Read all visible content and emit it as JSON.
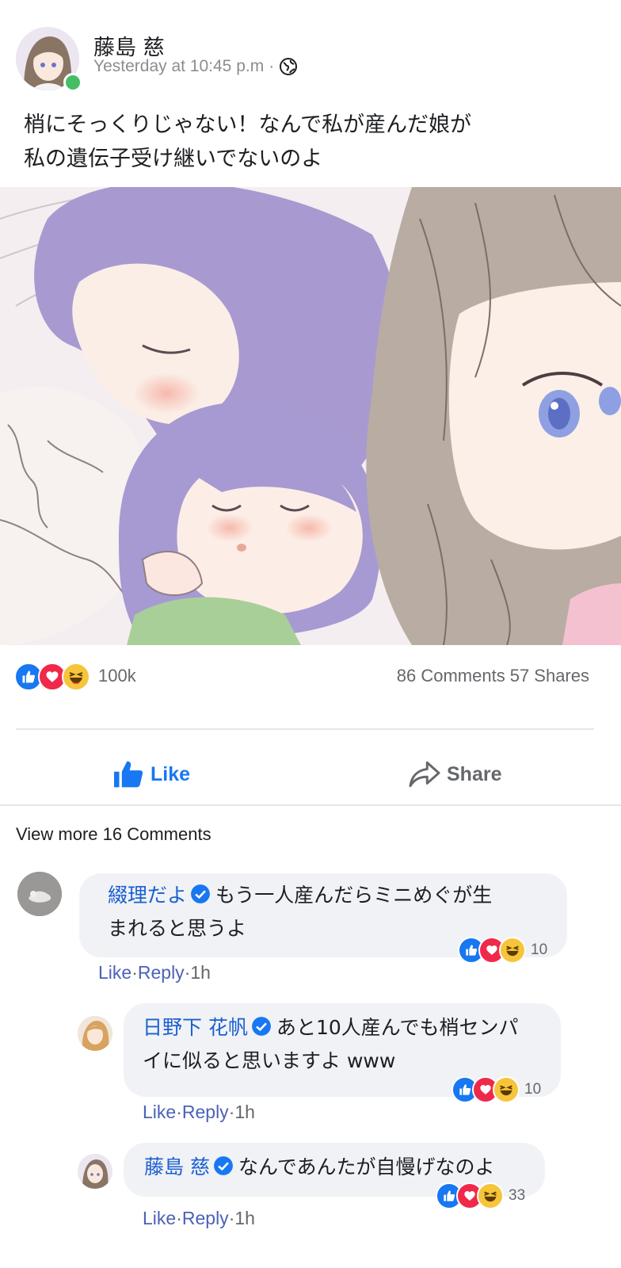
{
  "post": {
    "author": "藤島 慈",
    "timestamp": "Yesterday at 10:45 p.m",
    "separator": "·",
    "privacy_icon": "globe-icon",
    "online": true,
    "text_lines": [
      "梢にそっくりじゃない！なんで私が産んだ娘が",
      "私の遺伝子受け継いでないのよ"
    ],
    "image_icon": "illustration"
  },
  "stats": {
    "reactions": [
      "like",
      "love",
      "haha"
    ],
    "reaction_count": "100k",
    "comments": "86 Comments",
    "shares": "57 Shares"
  },
  "actions": {
    "like_label": "Like",
    "share_label": "Share"
  },
  "view_more": "View more 16 Comments",
  "comments": [
    {
      "name": "綴理だよ",
      "verified": true,
      "text_lines": [
        "もう一人産んだらミニめぐが生",
        "まれると思うよ"
      ],
      "reaction_count": "10",
      "like": "Like",
      "reply": "Reply",
      "time": "1h"
    },
    {
      "name": "日野下 花帆",
      "verified": true,
      "text_lines": [
        "あと10人産んでも梢センパ",
        "イに似ると思いますよ www"
      ],
      "reaction_count": "10",
      "like": "Like",
      "reply": "Reply",
      "time": "1h"
    },
    {
      "name": "藤島 慈",
      "verified": true,
      "text_lines": [
        "なんであんたが自慢げなのよ"
      ],
      "reaction_count": "33",
      "like": "Like",
      "reply": "Reply",
      "time": "1h"
    }
  ],
  "colors": {
    "accent": "#1877f2",
    "link": "#1c5fd1",
    "muted": "#65676b",
    "bubble": "#f0f2f5",
    "love": "#f0284a",
    "haha": "#f7c53b",
    "online": "#45bd62"
  }
}
